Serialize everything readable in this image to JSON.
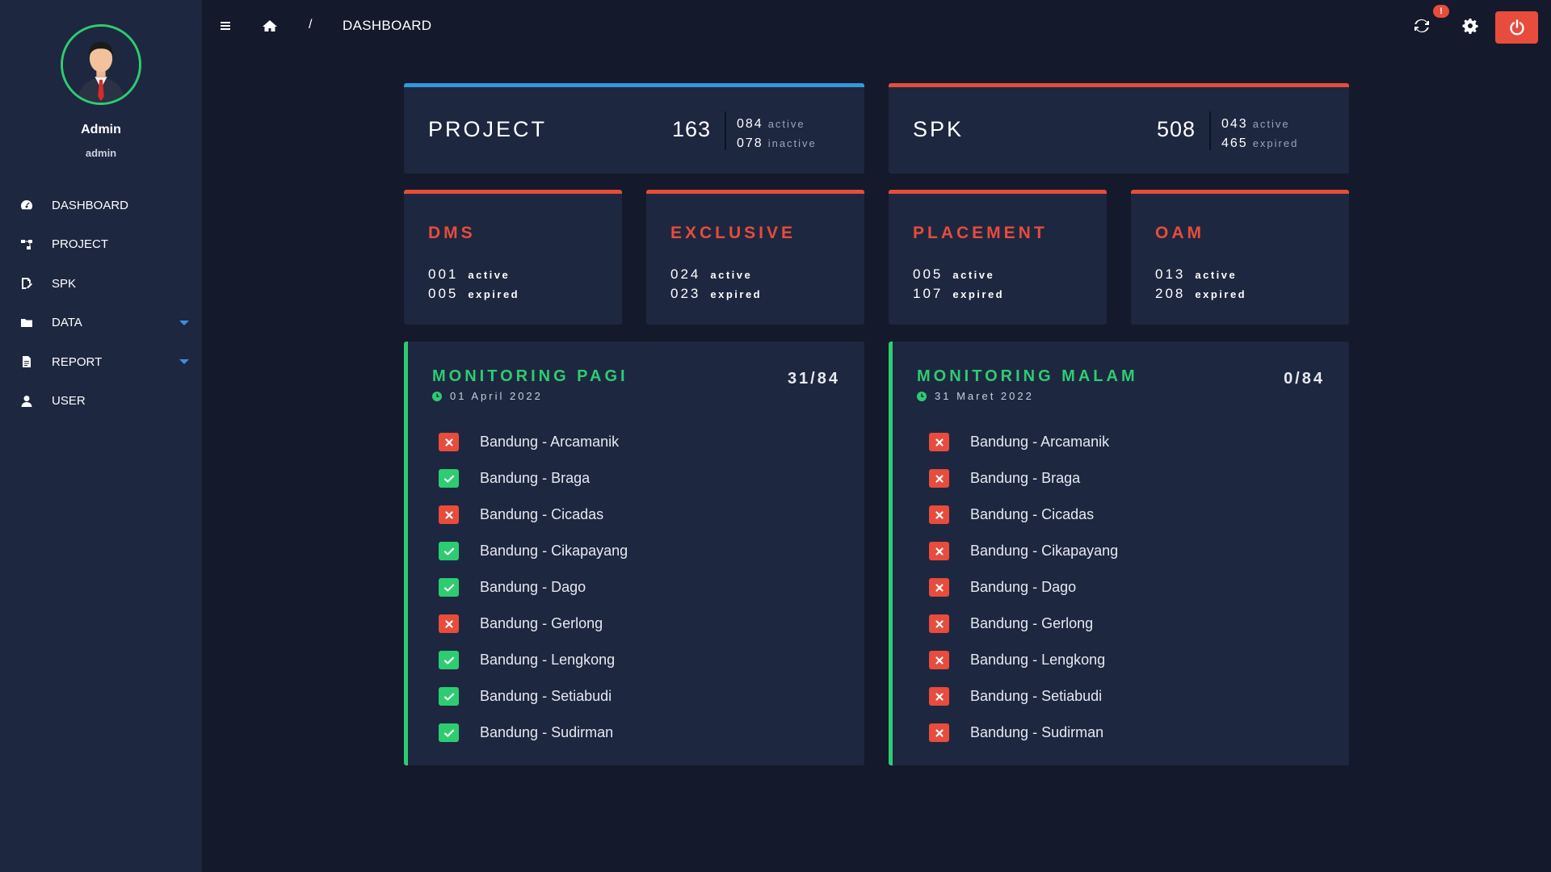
{
  "profile": {
    "name": "Admin",
    "role": "admin"
  },
  "nav": [
    {
      "label": "DASHBOARD",
      "icon": "dashboard-icon",
      "has_caret": false
    },
    {
      "label": "PROJECT",
      "icon": "sitemap-icon",
      "has_caret": false
    },
    {
      "label": "SPK",
      "icon": "edit-document-icon",
      "has_caret": false
    },
    {
      "label": "DATA",
      "icon": "folder-icon",
      "has_caret": true
    },
    {
      "label": "REPORT",
      "icon": "file-icon",
      "has_caret": true
    },
    {
      "label": "USER",
      "icon": "user-icon",
      "has_caret": false
    }
  ],
  "topbar": {
    "breadcrumb_sep": "/",
    "breadcrumb_current": "DASHBOARD",
    "notification_badge": "!"
  },
  "summary": {
    "project": {
      "title": "PROJECT",
      "total": "163",
      "line1_num": "084",
      "line1_label": "active",
      "line2_num": "078",
      "line2_label": "inactive"
    },
    "spk": {
      "title": "SPK",
      "total": "508",
      "line1_num": "043",
      "line1_label": "active",
      "line2_num": "465",
      "line2_label": "expired"
    }
  },
  "categories": [
    {
      "title": "DMS",
      "active_num": "001",
      "active_label": "active",
      "expired_num": "005",
      "expired_label": "expired"
    },
    {
      "title": "EXCLUSIVE",
      "active_num": "024",
      "active_label": "active",
      "expired_num": "023",
      "expired_label": "expired"
    },
    {
      "title": "PLACEMENT",
      "active_num": "005",
      "active_label": "active",
      "expired_num": "107",
      "expired_label": "expired"
    },
    {
      "title": "OAM",
      "active_num": "013",
      "active_label": "active",
      "expired_num": "208",
      "expired_label": "expired"
    }
  ],
  "monitoring": [
    {
      "title": "MONITORING PAGI",
      "count": "31/84",
      "date": "01 April 2022",
      "items": [
        {
          "label": "Bandung - Arcamanik",
          "ok": false
        },
        {
          "label": "Bandung - Braga",
          "ok": true
        },
        {
          "label": "Bandung - Cicadas",
          "ok": false
        },
        {
          "label": "Bandung - Cikapayang",
          "ok": true
        },
        {
          "label": "Bandung - Dago",
          "ok": true
        },
        {
          "label": "Bandung - Gerlong",
          "ok": false
        },
        {
          "label": "Bandung - Lengkong",
          "ok": true
        },
        {
          "label": "Bandung - Setiabudi",
          "ok": true
        },
        {
          "label": "Bandung - Sudirman",
          "ok": true
        }
      ]
    },
    {
      "title": "MONITORING MALAM",
      "count": "0/84",
      "date": "31 Maret 2022",
      "items": [
        {
          "label": "Bandung - Arcamanik",
          "ok": false
        },
        {
          "label": "Bandung - Braga",
          "ok": false
        },
        {
          "label": "Bandung - Cicadas",
          "ok": false
        },
        {
          "label": "Bandung - Cikapayang",
          "ok": false
        },
        {
          "label": "Bandung - Dago",
          "ok": false
        },
        {
          "label": "Bandung - Gerlong",
          "ok": false
        },
        {
          "label": "Bandung - Lengkong",
          "ok": false
        },
        {
          "label": "Bandung - Setiabudi",
          "ok": false
        },
        {
          "label": "Bandung - Sudirman",
          "ok": false
        }
      ]
    }
  ],
  "colors": {
    "accent_blue": "#3498db",
    "accent_red": "#e74c3c",
    "accent_green": "#2ecc71",
    "panel": "#1e2740",
    "background": "#141a2b"
  }
}
